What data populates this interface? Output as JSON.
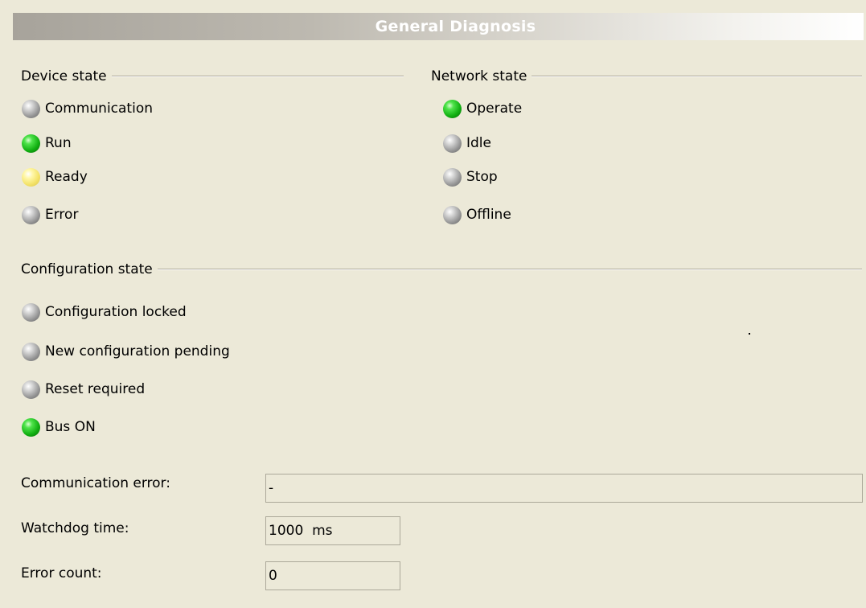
{
  "header": {
    "title": "General Diagnosis"
  },
  "device_state": {
    "title": "Device state",
    "items": [
      {
        "label": "Communication",
        "status": "gray"
      },
      {
        "label": "Run",
        "status": "green"
      },
      {
        "label": "Ready",
        "status": "yellow"
      },
      {
        "label": "Error",
        "status": "gray"
      }
    ]
  },
  "network_state": {
    "title": "Network state",
    "items": [
      {
        "label": "Operate",
        "status": "green"
      },
      {
        "label": "Idle",
        "status": "gray"
      },
      {
        "label": "Stop",
        "status": "gray"
      },
      {
        "label": "Offline",
        "status": "gray"
      }
    ]
  },
  "configuration_state": {
    "title": "Configuration state",
    "items": [
      {
        "label": "Configuration locked",
        "status": "gray"
      },
      {
        "label": "New configuration pending",
        "status": "gray"
      },
      {
        "label": "Reset required",
        "status": "gray"
      },
      {
        "label": "Bus ON",
        "status": "green"
      }
    ]
  },
  "fields": {
    "communication_error": {
      "label": "Communication error:",
      "value": "-"
    },
    "watchdog_time": {
      "label": "Watchdog time:",
      "value": "1000  ms"
    },
    "error_count": {
      "label": "Error count:",
      "value": "0"
    }
  },
  "colors": {
    "background": "#ece9d8",
    "led_green": "#12b012",
    "led_gray": "#9a9a9a",
    "led_yellow": "#f4e36a"
  }
}
